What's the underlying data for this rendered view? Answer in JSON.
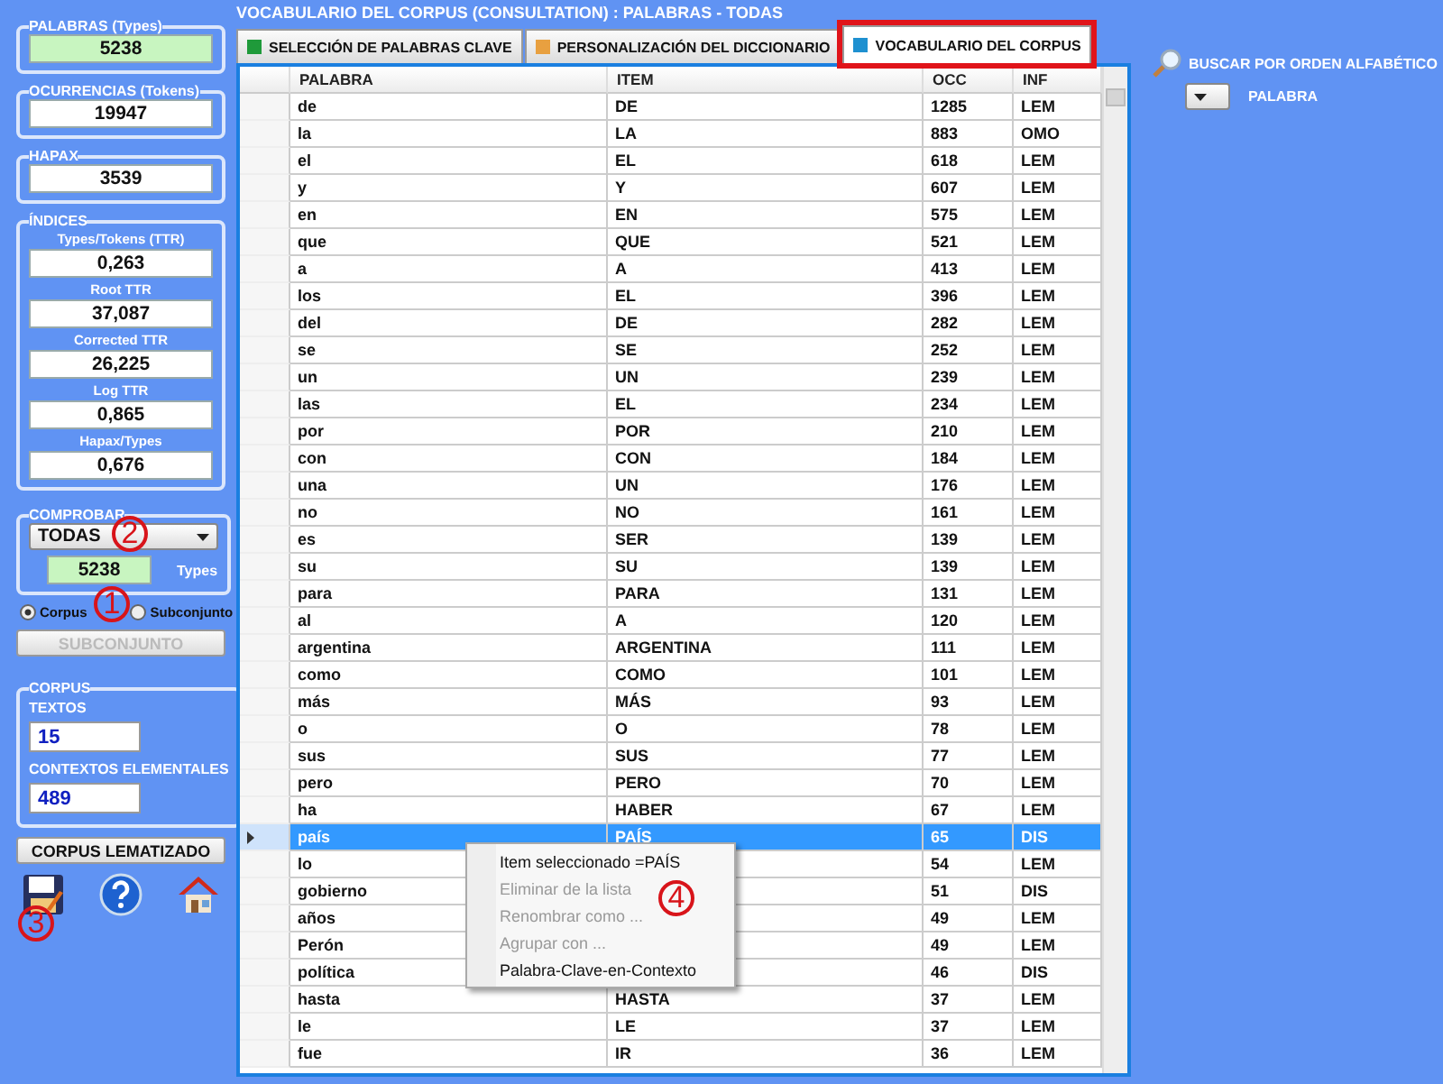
{
  "window": {
    "title": "VOCABULARIO DEL CORPUS (CONSULTATION) : PALABRAS  - TODAS"
  },
  "sidebar": {
    "stats": [
      {
        "legend": "PALABRAS  (Types)",
        "value": "5238",
        "highlighted": true
      },
      {
        "legend": "OCURRENCIAS (Tokens)",
        "value": "19947",
        "highlighted": false
      },
      {
        "legend": "HAPAX",
        "value": "3539",
        "highlighted": false
      }
    ],
    "indices": {
      "legend": "ÍNDICES",
      "items": [
        {
          "label": "Types/Tokens (TTR)",
          "value": "0,263"
        },
        {
          "label": "Root TTR",
          "value": "37,087"
        },
        {
          "label": "Corrected TTR",
          "value": "26,225"
        },
        {
          "label": "Log TTR",
          "value": "0,865"
        },
        {
          "label": "Hapax/Types",
          "value": "0,676"
        }
      ]
    },
    "check": {
      "legend": "COMPROBAR",
      "dropdown": "TODAS",
      "value": "5238",
      "unit": "Types"
    },
    "scope": [
      {
        "label": "Corpus",
        "selected": true
      },
      {
        "label": "Subconjunto",
        "selected": false
      }
    ],
    "subset_button": {
      "label": "SUBCONJUNTO",
      "disabled": true
    },
    "corpus": {
      "legend": "CORPUS",
      "fields": [
        {
          "label": "TEXTOS",
          "value": "15"
        },
        {
          "label": "CONTEXTOS ELEMENTALES",
          "value": "489"
        }
      ]
    },
    "lemma_button": "CORPUS LEMATIZADO",
    "tools": [
      {
        "kind": "save"
      },
      {
        "kind": "help"
      },
      {
        "kind": "home"
      }
    ]
  },
  "tabs": [
    {
      "label": "SELECCIÓN DE PALABRAS CLAVE",
      "selected": false,
      "highlighted": false,
      "color": "#1f9a3a"
    },
    {
      "label": "PERSONALIZACIÓN DEL DICCIONARIO",
      "selected": false,
      "highlighted": false,
      "color": "#e8a040"
    },
    {
      "label": "VOCABULARIO DEL CORPUS",
      "selected": true,
      "highlighted": true,
      "color": "#1e90d0"
    }
  ],
  "table": {
    "columns": [
      "PALABRA",
      "ITEM",
      "OCC",
      "INF"
    ],
    "rows": [
      {
        "palabra": "de",
        "item": "DE",
        "occ": "1285",
        "inf": "LEM",
        "selected": false
      },
      {
        "palabra": "la",
        "item": "LA",
        "occ": "883",
        "inf": "OMO",
        "selected": false
      },
      {
        "palabra": "el",
        "item": "EL",
        "occ": "618",
        "inf": "LEM",
        "selected": false
      },
      {
        "palabra": "y",
        "item": "Y",
        "occ": "607",
        "inf": "LEM",
        "selected": false
      },
      {
        "palabra": "en",
        "item": "EN",
        "occ": "575",
        "inf": "LEM",
        "selected": false
      },
      {
        "palabra": "que",
        "item": "QUE",
        "occ": "521",
        "inf": "LEM",
        "selected": false
      },
      {
        "palabra": "a",
        "item": "A",
        "occ": "413",
        "inf": "LEM",
        "selected": false
      },
      {
        "palabra": "los",
        "item": "EL",
        "occ": "396",
        "inf": "LEM",
        "selected": false
      },
      {
        "palabra": "del",
        "item": "DE",
        "occ": "282",
        "inf": "LEM",
        "selected": false
      },
      {
        "palabra": "se",
        "item": "SE",
        "occ": "252",
        "inf": "LEM",
        "selected": false
      },
      {
        "palabra": "un",
        "item": "UN",
        "occ": "239",
        "inf": "LEM",
        "selected": false
      },
      {
        "palabra": "las",
        "item": "EL",
        "occ": "234",
        "inf": "LEM",
        "selected": false
      },
      {
        "palabra": "por",
        "item": "POR",
        "occ": "210",
        "inf": "LEM",
        "selected": false
      },
      {
        "palabra": "con",
        "item": "CON",
        "occ": "184",
        "inf": "LEM",
        "selected": false
      },
      {
        "palabra": "una",
        "item": "UN",
        "occ": "176",
        "inf": "LEM",
        "selected": false
      },
      {
        "palabra": "no",
        "item": "NO",
        "occ": "161",
        "inf": "LEM",
        "selected": false
      },
      {
        "palabra": "es",
        "item": "SER",
        "occ": "139",
        "inf": "LEM",
        "selected": false
      },
      {
        "palabra": "su",
        "item": "SU",
        "occ": "139",
        "inf": "LEM",
        "selected": false
      },
      {
        "palabra": "para",
        "item": "PARA",
        "occ": "131",
        "inf": "LEM",
        "selected": false
      },
      {
        "palabra": "al",
        "item": "A",
        "occ": "120",
        "inf": "LEM",
        "selected": false
      },
      {
        "palabra": "argentina",
        "item": "ARGENTINA",
        "occ": "111",
        "inf": "LEM",
        "selected": false
      },
      {
        "palabra": "como",
        "item": "COMO",
        "occ": "101",
        "inf": "LEM",
        "selected": false
      },
      {
        "palabra": "más",
        "item": "MÁS",
        "occ": "93",
        "inf": "LEM",
        "selected": false
      },
      {
        "palabra": "o",
        "item": "O",
        "occ": "78",
        "inf": "LEM",
        "selected": false
      },
      {
        "palabra": "sus",
        "item": "SUS",
        "occ": "77",
        "inf": "LEM",
        "selected": false
      },
      {
        "palabra": "pero",
        "item": "PERO",
        "occ": "70",
        "inf": "LEM",
        "selected": false
      },
      {
        "palabra": "ha",
        "item": "HABER",
        "occ": "67",
        "inf": "LEM",
        "selected": false
      },
      {
        "palabra": "país",
        "item": "PAÍS",
        "occ": "65",
        "inf": "DIS",
        "selected": true
      },
      {
        "palabra": "lo",
        "occ": "54",
        "inf": "LEM",
        "selected": false
      },
      {
        "palabra": "gobierno",
        "occ": "51",
        "inf": "DIS",
        "selected": false
      },
      {
        "palabra": "años",
        "occ": "49",
        "inf": "LEM",
        "selected": false
      },
      {
        "palabra": "Perón",
        "occ": "49",
        "inf": "LEM",
        "selected": false
      },
      {
        "palabra": "política",
        "occ": "46",
        "inf": "DIS",
        "selected": false
      },
      {
        "palabra": "hasta",
        "item": "HASTA",
        "occ": "37",
        "inf": "LEM",
        "selected": false
      },
      {
        "palabra": "le",
        "item": "LE",
        "occ": "37",
        "inf": "LEM",
        "selected": false
      },
      {
        "palabra": "fue",
        "item": "IR",
        "occ": "36",
        "inf": "LEM",
        "selected": false
      }
    ]
  },
  "context_menu": [
    {
      "label": "Item seleccionado =PAÍS",
      "disabled": false
    },
    {
      "label": "Eliminar de la lista",
      "disabled": true
    },
    {
      "label": "Renombrar como ...",
      "disabled": true
    },
    {
      "label": "Agrupar con ...",
      "disabled": true
    },
    {
      "label": "Palabra-Clave-en-Contexto",
      "disabled": false
    }
  ],
  "search": {
    "label": "BUSCAR POR ORDEN ALFABÉTICO",
    "field": "PALABRA"
  },
  "annotations": [
    "2",
    "1",
    "3",
    "4"
  ]
}
